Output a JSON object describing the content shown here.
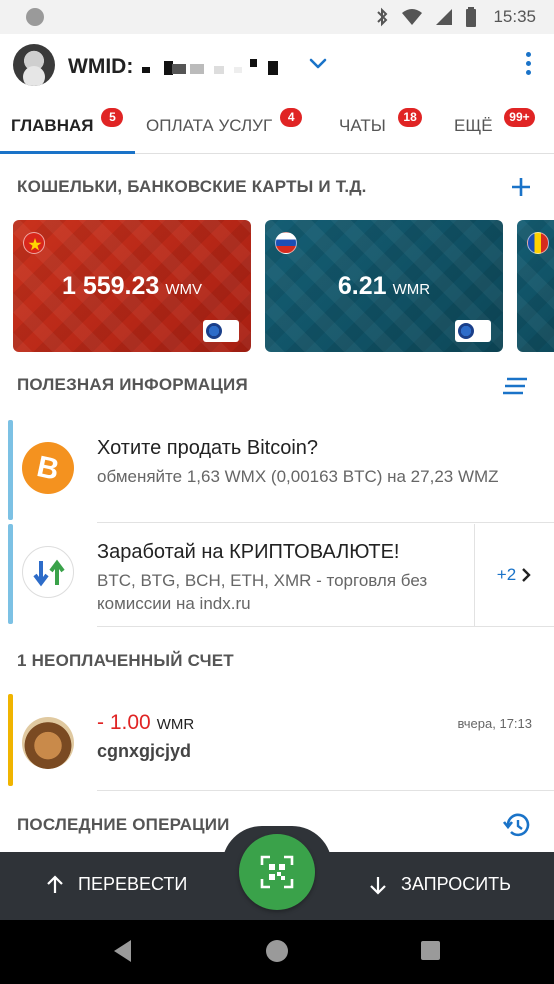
{
  "status_bar": {
    "time": "15:35"
  },
  "header": {
    "wmid_label": "WMID:"
  },
  "tabs": [
    {
      "label": "ГЛАВНАЯ",
      "badge": "5"
    },
    {
      "label": "ОПЛАТА УСЛУГ",
      "badge": "4"
    },
    {
      "label": "ЧАТЫ",
      "badge": "18"
    },
    {
      "label": "ЕЩЁ",
      "badge": "99+"
    }
  ],
  "wallets": {
    "title": "КОШЕЛЬКИ, БАНКОВСКИЕ КАРТЫ И Т.Д.",
    "items": [
      {
        "amount": "1 559.23",
        "currency": "WMV"
      },
      {
        "amount": "6.21",
        "currency": "WMR"
      }
    ]
  },
  "info": {
    "title": "ПОЛЕЗНАЯ ИНФОРМАЦИЯ",
    "items": [
      {
        "title": "Хотите продать Bitcoin?",
        "desc": "обменяйте 1,63 WMX (0,00163 BTC) на 27,23 WMZ"
      },
      {
        "title": "Заработай на КРИПТОВАЛЮТЕ!",
        "desc": "BTC, BTG, BCH, ETH, XMR - торговля без комиссии на indx.ru",
        "more": "+2"
      }
    ]
  },
  "invoices": {
    "title": "1 НЕОПЛАЧЕННЫЙ СЧЕТ",
    "items": [
      {
        "amount": "- 1.00",
        "currency": "WMR",
        "time": "вчера, 17:13",
        "name": "cgnxgjcjyd"
      }
    ]
  },
  "operations": {
    "title": "ПОСЛЕДНИЕ ОПЕРАЦИИ"
  },
  "bottom_bar": {
    "send_label": "ПЕРЕВЕСТИ",
    "request_label": "ЗАПРОСИТЬ"
  },
  "colors": {
    "accent": "#1a73c8",
    "badge": "#e02424",
    "invoice_accent": "#f0b400",
    "info_accent": "#7cc1e4",
    "qr_button": "#3aa24a"
  }
}
